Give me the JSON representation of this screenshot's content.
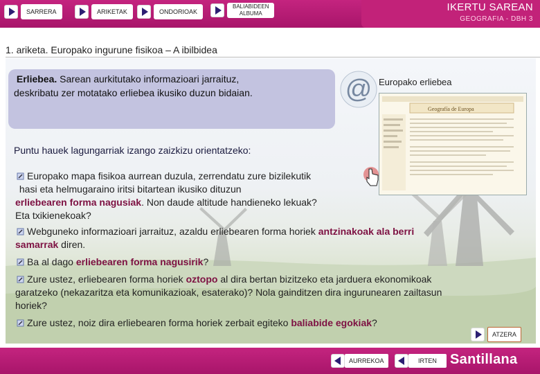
{
  "nav": {
    "items": [
      {
        "label": "SARRERA"
      },
      {
        "label": "ARIKETAK"
      },
      {
        "label": "ONDORIOAK"
      },
      {
        "label_line1": "BALIABIDEEN",
        "label_line2": "ALBUMA"
      }
    ]
  },
  "header": {
    "title": "IKERTU SAREAN",
    "subtitle": "GEOGRAFIA - DBH 3"
  },
  "page_title": "1. ariketa. Europako ingurune fisikoa – A ibilbidea",
  "task": {
    "bold": "Erliebea.",
    "line1_rest": " Sarean aurkitutako informazioari jarraituz,",
    "line2": "deskribatu zer motatako erliebea ikusiko duzun bidaian."
  },
  "link": {
    "label": "Europako erliebea",
    "thumb_title": "Geografía de Europa"
  },
  "hint": "Puntu hauek lagungarriak izango zaizkizu orientatzeko:",
  "questions": {
    "q1": {
      "l1": "Europako mapa fisikoa aurrean duzula, zerrendatu zure bizilekutik",
      "l2": "hasi eta helmugaraino iritsi bitartean ikusiko dituzun",
      "l3_hl": "erliebearen forma nagusiak",
      "l3_rest": ". Non daude altitude handieneko lekuak?",
      "l4": "Eta txikienekoak?"
    },
    "q2": {
      "l1_pre": "Webguneko informazioari jarraituz, azaldu erliebearen forma horiek ",
      "l1_hl": "antzinakoak ala berri",
      "l2_hl": "samarrak",
      "l2_rest": " diren."
    },
    "q3": {
      "pre": "Ba al dago ",
      "hl": "erliebearen forma nagusirik",
      "post": "?"
    },
    "q4": {
      "l1_pre": "Zure ustez, erliebearen forma horiek ",
      "l1_hl": "oztopo",
      "l1_post": " al dira bertan bizitzeko eta jarduera ekonomikoak",
      "l2": "garatzeko (nekazaritza eta komunikazioak, esaterako)? Nola gainditzen dira ingurunearen zailtasun",
      "l3": "horiek?"
    },
    "q5": {
      "pre": "Zure ustez, noiz dira erliebearen forma horiek zerbait egiteko ",
      "hl": "baliabide egokiak",
      "post": "?"
    }
  },
  "footer": {
    "back_label": "ATZERA",
    "prev_label": "AURREKOA",
    "exit_label": "IRTEN",
    "brand": "Santillana"
  },
  "colors": {
    "bar": "#b61a72",
    "task_box": "#c3c3e0",
    "highlight": "#7d1142"
  }
}
